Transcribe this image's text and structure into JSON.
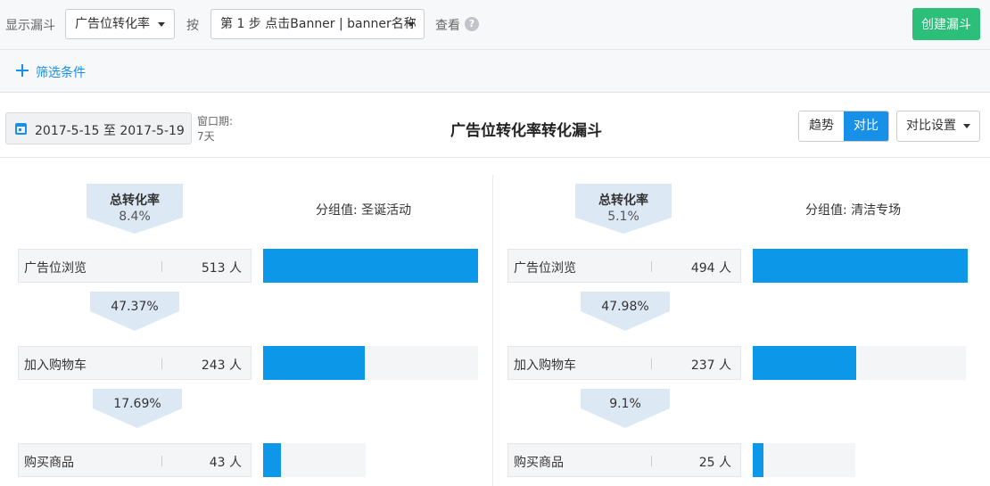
{
  "toolbar": {
    "show_label": "显示漏斗",
    "funnel_select": "广告位转化率",
    "by_label": "按",
    "step_select": "第 1 步 点击Banner | banner名称",
    "view_label": "查看",
    "help_glyph": "?",
    "create_label": "创建漏斗"
  },
  "filter": {
    "add_label": "筛选条件"
  },
  "range": {
    "date": "2017-5-15 至 2017-5-19",
    "window_label": "窗口期:",
    "window_value": "7天"
  },
  "funnel_title": "广告位转化率转化漏斗",
  "view_toggle": {
    "trend": "趋势",
    "compare": "对比",
    "active": "compare"
  },
  "compare_settings": "对比设置",
  "colors": {
    "accent": "#1890e8",
    "bar": "#0d97e8",
    "create": "#2cbf7a"
  },
  "groups": [
    {
      "label": "分组值: 圣诞活动",
      "total_label": "总转化率",
      "total_value": "8.4%",
      "steps": [
        {
          "name": "广告位浏览",
          "count": "513 人",
          "fraction": 1.0
        },
        {
          "name": "加入购物车",
          "count": "243 人",
          "fraction": 0.4737
        },
        {
          "name": "购买商品",
          "count": "43 人",
          "fraction": 0.0838
        }
      ],
      "conversions": [
        "47.37%",
        "17.69%"
      ]
    },
    {
      "label": "分组值: 清洁专场",
      "total_label": "总转化率",
      "total_value": "5.1%",
      "steps": [
        {
          "name": "广告位浏览",
          "count": "494 人",
          "fraction": 1.0
        },
        {
          "name": "加入购物车",
          "count": "237 人",
          "fraction": 0.4798
        },
        {
          "name": "购买商品",
          "count": "25 人",
          "fraction": 0.0506
        }
      ],
      "conversions": [
        "47.98%",
        "9.1%"
      ]
    }
  ]
}
